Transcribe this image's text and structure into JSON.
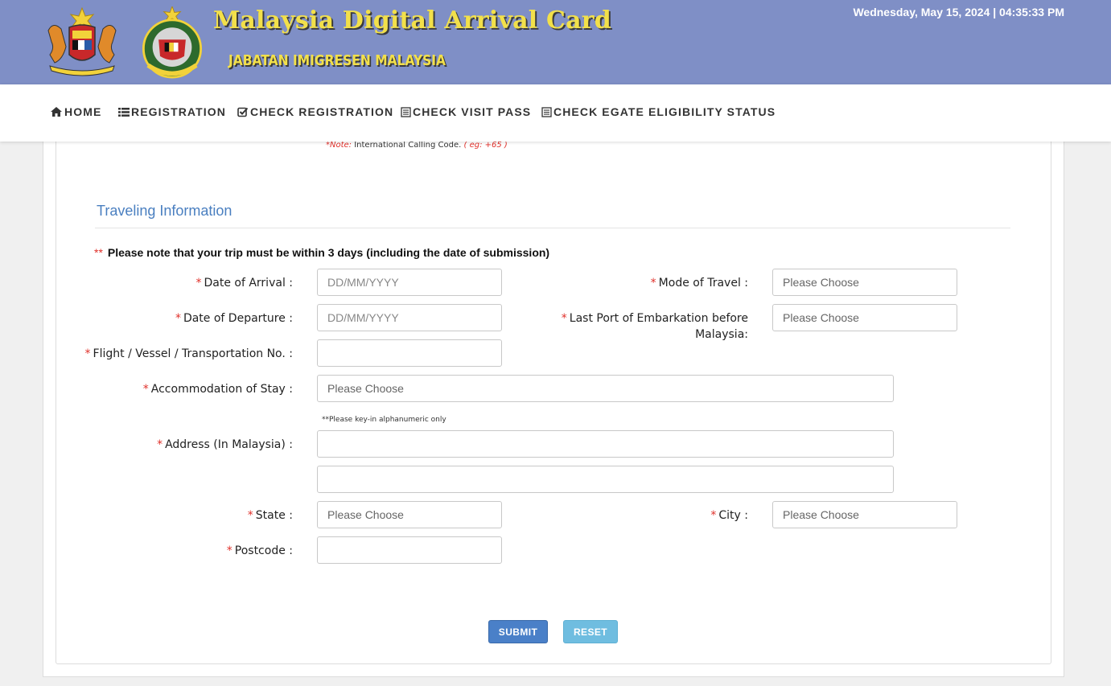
{
  "header": {
    "title": "Malaysia Digital Arrival Card",
    "subtitle": "JABATAN IMIGRESEN MALAYSIA",
    "datetime": "Wednesday, May 15, 2024 | 04:35:33 PM",
    "colors": {
      "background": "#7f8fc6",
      "title": "#f2e04a"
    }
  },
  "nav": {
    "items": [
      {
        "label": "HOME",
        "icon": "home-icon"
      },
      {
        "label": "REGISTRATION",
        "icon": "list-icon"
      },
      {
        "label": "CHECK REGISTRATION",
        "icon": "check-square-icon"
      },
      {
        "label": "CHECK VISIT PASS",
        "icon": "document-icon"
      },
      {
        "label": "CHECK EGATE ELIGIBILITY STATUS",
        "icon": "document-icon"
      }
    ]
  },
  "phone_note": {
    "prefix": "*Note:",
    "text": " International Calling Code. ",
    "example": "( eg: +65 )"
  },
  "section": {
    "title": "Traveling Information",
    "trip_note_marker": "**",
    "trip_note": "Please note that your trip must be within 3 days (including the date of submission)"
  },
  "form": {
    "required_marker": "*",
    "date_of_arrival": {
      "label": "Date of Arrival :",
      "placeholder": "DD/MM/YYYY"
    },
    "date_of_departure": {
      "label": "Date of Departure :",
      "placeholder": "DD/MM/YYYY"
    },
    "flight_no": {
      "label": "Flight / Vessel / Transportation No. :",
      "value": ""
    },
    "mode_of_travel": {
      "label": "Mode of Travel :",
      "value": "Please Choose"
    },
    "last_port": {
      "label_line1": "Last Port of Embarkation before",
      "label_line2": "Malaysia:",
      "value": "Please Choose"
    },
    "accommodation": {
      "label": "Accommodation of Stay :",
      "value": "Please Choose"
    },
    "address_hint": "**Please key-in alphanumeric only",
    "address": {
      "label": "Address (In Malaysia) :",
      "line1": "",
      "line2": ""
    },
    "state": {
      "label": "State :",
      "value": "Please Choose"
    },
    "city": {
      "label": "City :",
      "value": "Please Choose"
    },
    "postcode": {
      "label": "Postcode :",
      "value": ""
    }
  },
  "buttons": {
    "submit": "SUBMIT",
    "reset": "RESET"
  }
}
